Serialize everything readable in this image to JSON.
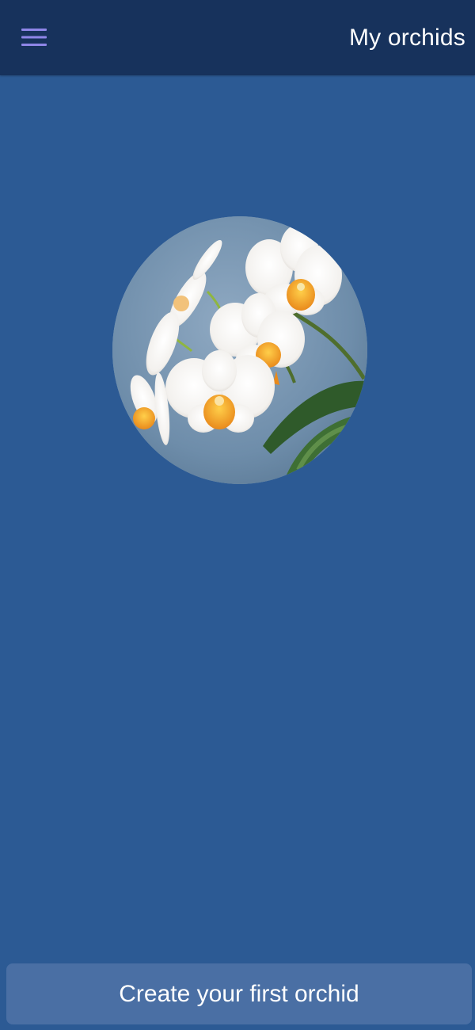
{
  "header": {
    "title": "My orchids",
    "menu_icon": "hamburger-menu-icon"
  },
  "main": {
    "hero_image": "orchid-photo"
  },
  "footer": {
    "create_button_label": "Create your first orchid"
  },
  "colors": {
    "background": "#2c5a94",
    "app_bar": "#17325c",
    "menu_icon": "#8f86e8",
    "button": "#4a6fa4",
    "text": "#ffffff"
  }
}
